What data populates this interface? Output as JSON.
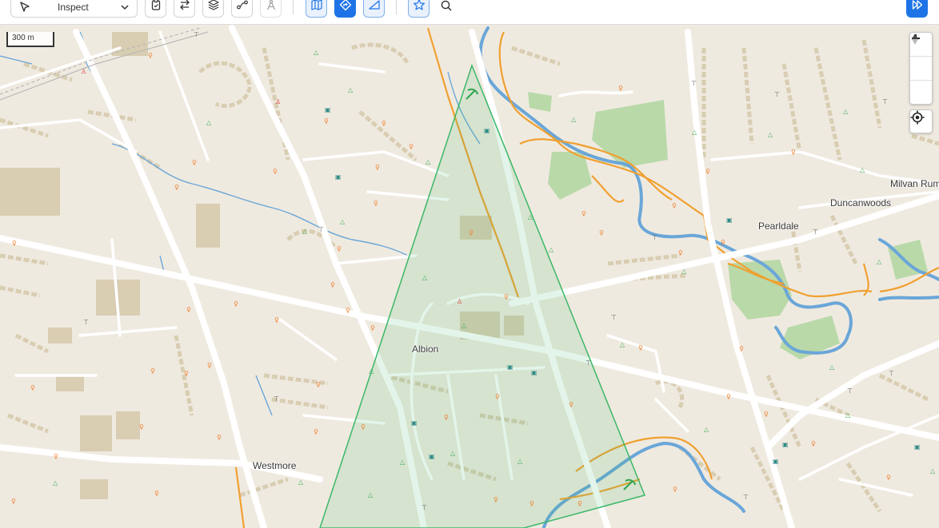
{
  "toolbar": {
    "mode_label": "Inspect",
    "icons": [
      "cursor-arrow-icon",
      "chevron-down-icon",
      "clipboard-icon",
      "swap-arrows-icon",
      "layers-icon",
      "route-icon",
      "compass-icon",
      "map-icon",
      "navigation-icon",
      "ruler-icon",
      "star-icon",
      "search-icon",
      "fast-forward-icon"
    ],
    "accent_color": "#1e74e6"
  },
  "map": {
    "scale_label": "300 m",
    "places": [
      {
        "id": "albion",
        "name": "Albion"
      },
      {
        "id": "westmore",
        "name": "Westmore"
      },
      {
        "id": "pearldale",
        "name": "Pearldale"
      },
      {
        "id": "duncanwoods",
        "name": "Duncanwoods"
      },
      {
        "id": "milvan",
        "name": "Milvan Rum"
      }
    ],
    "controls": {
      "zoom_in": "+",
      "zoom_out": "−"
    },
    "colors": {
      "land": "#efeae0",
      "building": "#d8ccb1",
      "road": "#ffffff",
      "highway": "#f0a030",
      "water": "#5a9fd6",
      "park": "#b7d8a8",
      "highlight": "#3cb868"
    }
  }
}
